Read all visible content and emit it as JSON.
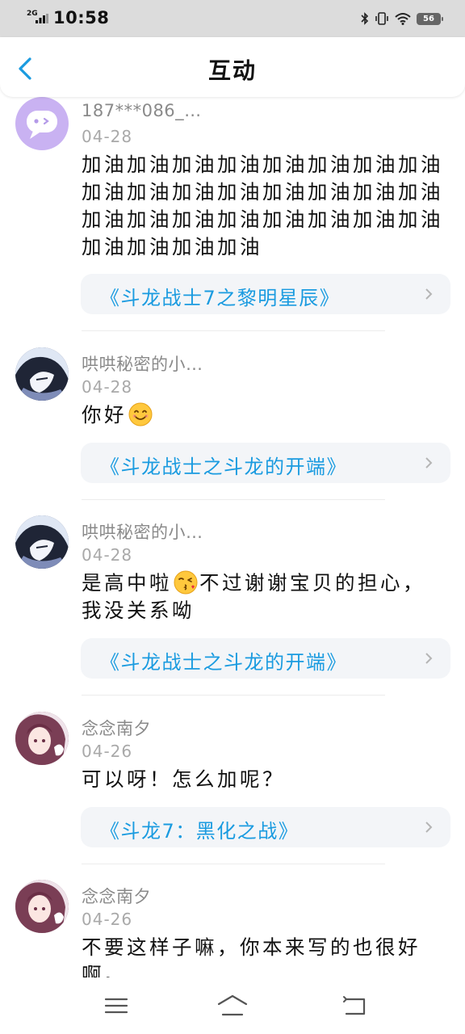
{
  "status": {
    "network": "2G",
    "time": "10:58",
    "battery": "56"
  },
  "header": {
    "title": "互动"
  },
  "comments": [
    {
      "user": "187***086_…",
      "date": "04-28",
      "text": "加油加油加油加油加油加油加油加油加油加油加油加油加油加油加油加油加油加油加油加油加油加油加油加油加油加油加油加油",
      "book": "《斗龙战士7之黎明星辰》"
    },
    {
      "user": "哄哄秘密的小…",
      "date": "04-28",
      "text": "你好",
      "book": "《斗龙战士之斗龙的开端》"
    },
    {
      "user": "哄哄秘密的小…",
      "date": "04-28",
      "text_a": "是高中啦",
      "text_b": "不过谢谢宝贝的担心，我没关系呦",
      "book": "《斗龙战士之斗龙的开端》"
    },
    {
      "user": "念念南夕",
      "date": "04-26",
      "text": "可以呀！怎么加呢？",
      "book": "《斗龙7：黑化之战》"
    },
    {
      "user": "念念南夕",
      "date": "04-26",
      "text": "不要这样子嘛，你本来写的也很好啊。"
    }
  ],
  "colors": {
    "link": "#1a9be0",
    "back": "#1a9be0"
  },
  "icons": [
    "back-arrow-icon",
    "chevron-right-icon",
    "smile-emoji",
    "kiss-emoji",
    "menu-icon",
    "home-icon",
    "return-icon"
  ]
}
